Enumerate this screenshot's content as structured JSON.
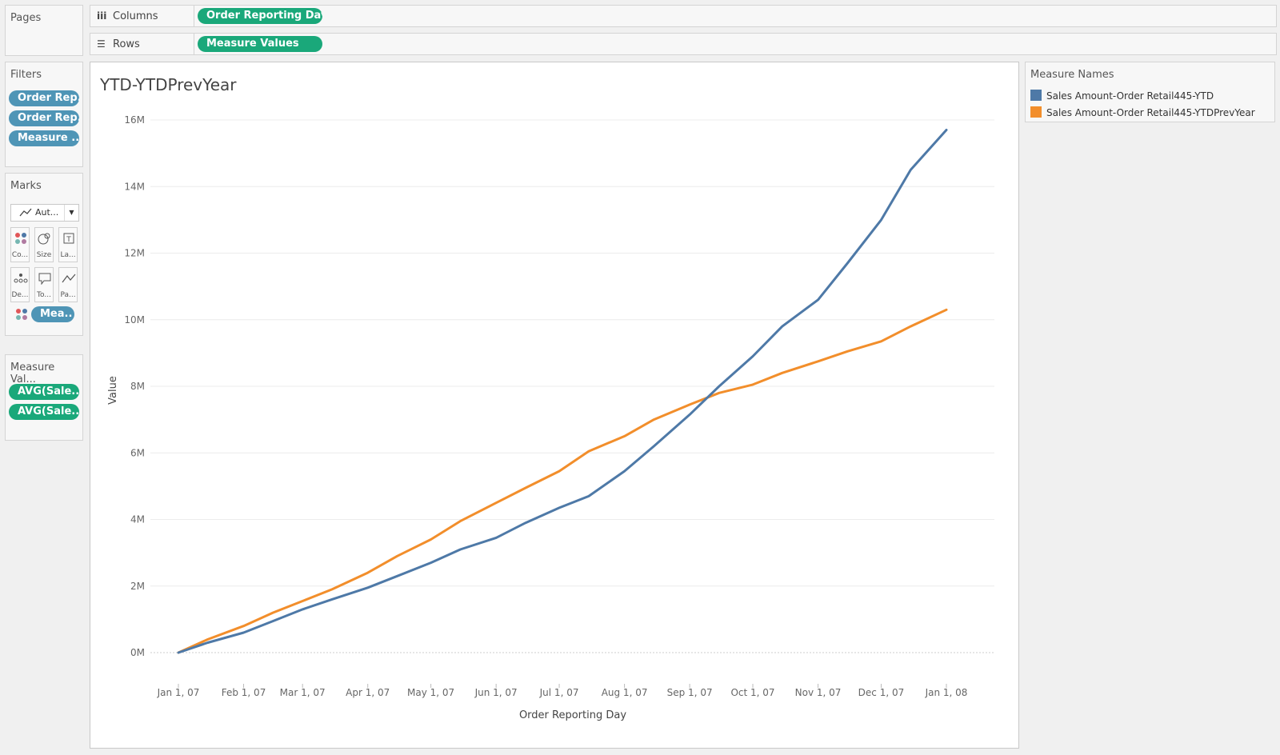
{
  "pages": {
    "title": "Pages"
  },
  "columns_shelf": {
    "label": "Columns",
    "pill": "Order Reporting Day"
  },
  "rows_shelf": {
    "label": "Rows",
    "pill": "Measure Values"
  },
  "filters": {
    "title": "Filters",
    "pills": [
      "Order Rep..",
      "Order Rep..",
      "Measure .."
    ]
  },
  "marks": {
    "title": "Marks",
    "type_label": "Aut...",
    "cards": [
      "Co...",
      "Size",
      "La...",
      "De...",
      "To...",
      "Pa..."
    ],
    "color_pill": "Mea.."
  },
  "measure_values": {
    "title": "Measure Val...",
    "pills": [
      "AVG(Sale..",
      "AVG(Sale.."
    ]
  },
  "legend": {
    "title": "Measure Names",
    "items": [
      {
        "label": "Sales Amount-Order Retail445-YTD",
        "color": "#4e79a7"
      },
      {
        "label": "Sales Amount-Order Retail445-YTDPrevYear",
        "color": "#f28e2b"
      }
    ]
  },
  "chart_data": {
    "type": "line",
    "title": "YTD-YTDPrevYear",
    "xlabel": "Order Reporting Day",
    "ylabel": "Value",
    "x_ticks": [
      "Jan 1, 07",
      "Feb 1, 07",
      "Mar 1, 07",
      "Apr 1, 07",
      "May 1, 07",
      "Jun 1, 07",
      "Jul 1, 07",
      "Aug 1, 07",
      "Sep 1, 07",
      "Oct 1, 07",
      "Nov 1, 07",
      "Dec 1, 07",
      "Jan 1, 08"
    ],
    "y_ticks": [
      "0M",
      "2M",
      "4M",
      "6M",
      "8M",
      "10M",
      "12M",
      "14M",
      "16M"
    ],
    "ylim": [
      -1000000,
      16500000
    ],
    "grid": true,
    "x": [
      "2007-01-01",
      "2007-01-15",
      "2007-02-01",
      "2007-02-15",
      "2007-03-01",
      "2007-03-15",
      "2007-04-01",
      "2007-04-15",
      "2007-05-01",
      "2007-05-15",
      "2007-06-01",
      "2007-06-15",
      "2007-07-01",
      "2007-07-15",
      "2007-08-01",
      "2007-08-15",
      "2007-09-01",
      "2007-09-15",
      "2007-10-01",
      "2007-10-15",
      "2007-11-01",
      "2007-11-15",
      "2007-12-01",
      "2007-12-15",
      "2008-01-01"
    ],
    "series": [
      {
        "name": "Sales Amount-Order Retail445-YTD",
        "color": "#4e79a7",
        "values": [
          0,
          300000,
          600000,
          950000,
          1300000,
          1600000,
          1950000,
          2300000,
          2700000,
          3100000,
          3450000,
          3900000,
          4350000,
          4700000,
          5450000,
          6200000,
          7150000,
          8000000,
          8900000,
          9800000,
          10600000,
          11700000,
          13000000,
          14500000,
          15700000
        ]
      },
      {
        "name": "Sales Amount-Order Retail445-YTDPrevYear",
        "color": "#f28e2b",
        "values": [
          0,
          400000,
          800000,
          1200000,
          1550000,
          1900000,
          2400000,
          2900000,
          3400000,
          3950000,
          4500000,
          4950000,
          5450000,
          6050000,
          6500000,
          7000000,
          7450000,
          7800000,
          8050000,
          8400000,
          8750000,
          9050000,
          9350000,
          9800000,
          10300000
        ]
      }
    ]
  }
}
